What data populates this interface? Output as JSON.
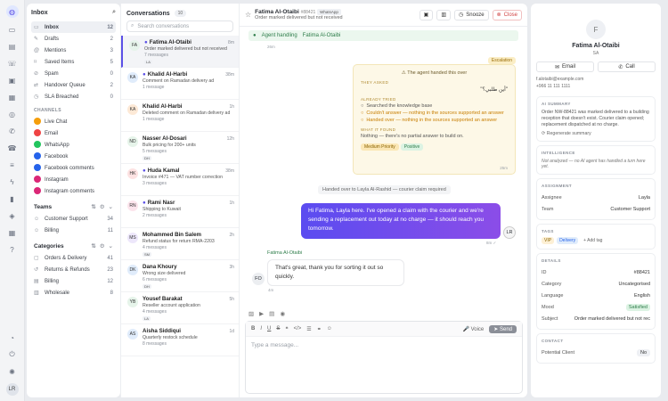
{
  "rail": {
    "icons": [
      "chat-logo-icon",
      "inbox-icon",
      "document-icon",
      "contacts-icon",
      "archive-icon",
      "box-icon",
      "broadcast-icon",
      "phone-icon",
      "call-icon",
      "sliders-icon",
      "bolt-icon",
      "chart-icon",
      "layers-icon",
      "table-icon",
      "help-icon",
      "bell-icon",
      "power-icon",
      "light-icon"
    ],
    "avatar": "LR"
  },
  "sidebar": {
    "title": "Inbox",
    "items": [
      {
        "label": "Inbox",
        "count": "12"
      },
      {
        "label": "Drafts",
        "count": "2"
      },
      {
        "label": "Mentions",
        "count": "3"
      },
      {
        "label": "Saved Items",
        "count": "5"
      },
      {
        "label": "Spam",
        "count": "0"
      },
      {
        "label": "Handover Queue",
        "count": "2"
      },
      {
        "label": "SLA Breached",
        "count": "0"
      }
    ],
    "channels_label": "CHANNELS",
    "channels": [
      {
        "label": "Live Chat",
        "color": "#f59e0b"
      },
      {
        "label": "Email",
        "color": "#ef4444"
      },
      {
        "label": "WhatsApp",
        "color": "#22c55e"
      },
      {
        "label": "Facebook",
        "color": "#2563eb"
      },
      {
        "label": "Facebook comments",
        "color": "#2563eb"
      },
      {
        "label": "Instagram",
        "color": "#db2777"
      },
      {
        "label": "Instagram comments",
        "color": "#db2777"
      }
    ],
    "teams_label": "Teams",
    "teams": [
      {
        "label": "Customer Support",
        "count": "34"
      },
      {
        "label": "Billing",
        "count": "11"
      }
    ],
    "categories_label": "Categories",
    "categories": [
      {
        "label": "Orders & Delivery",
        "count": "41"
      },
      {
        "label": "Returns & Refunds",
        "count": "23"
      },
      {
        "label": "Billing",
        "count": "12"
      },
      {
        "label": "Wholesale",
        "count": "8"
      }
    ]
  },
  "conversations": {
    "title": "Conversations",
    "count": "10",
    "search_placeholder": "Search conversations",
    "items": [
      {
        "initials": "FA",
        "name": "Fatima Al-Otaibi",
        "time": "8m",
        "preview": "Order marked delivered but not received",
        "count": "7 messages",
        "tag": "LA",
        "unread": true,
        "bg": "#e6f4ea"
      },
      {
        "initials": "KA",
        "name": "Khalid Al-Harbi",
        "time": "38m",
        "preview": "Comment on Ramadan delivery ad",
        "count": "1 message",
        "tag": "",
        "unread": true,
        "bg": "#e0ecfb"
      },
      {
        "initials": "KA",
        "name": "Khalid Al-Harbi",
        "time": "1h",
        "preview": "Deleted comment on Ramadan delivery ad",
        "count": "1 message",
        "tag": "",
        "unread": false,
        "bg": "#fde9d6"
      },
      {
        "initials": "ND",
        "name": "Nasser Al-Dosari",
        "time": "12h",
        "preview": "Bulk pricing for 200+ units",
        "count": "5 messages",
        "tag": "DH",
        "unread": false,
        "bg": "#e6f4ea"
      },
      {
        "initials": "HK",
        "name": "Huda Kamal",
        "time": "38m",
        "preview": "Invoice #471 — VAT number correction",
        "count": "3 messages",
        "tag": "",
        "unread": true,
        "bg": "#fde2e2"
      },
      {
        "initials": "RN",
        "name": "Rami Nasr",
        "time": "1h",
        "preview": "Shipping to Kuwait",
        "count": "2 messages",
        "tag": "",
        "unread": true,
        "bg": "#fce4ec"
      },
      {
        "initials": "MS",
        "name": "Mohammed Bin Salem",
        "time": "2h",
        "preview": "Refund status for return RMA-2203",
        "count": "4 messages",
        "tag": "SM",
        "unread": false,
        "bg": "#ede7fb"
      },
      {
        "initials": "DK",
        "name": "Dana Khoury",
        "time": "3h",
        "preview": "Wrong size delivered",
        "count": "6 messages",
        "tag": "DH",
        "unread": false,
        "bg": "#e0ecfb"
      },
      {
        "initials": "YB",
        "name": "Yousef Barakat",
        "time": "5h",
        "preview": "Reseller account application",
        "count": "4 messages",
        "tag": "LA",
        "unread": false,
        "bg": "#e6f4ea"
      },
      {
        "initials": "AS",
        "name": "Aisha Siddiqui",
        "time": "1d",
        "preview": "Quarterly restock schedule",
        "count": "8 messages",
        "tag": "",
        "unread": false,
        "bg": "#e0ecfb"
      }
    ]
  },
  "thread": {
    "name": "Fatima Al-Otaibi",
    "id": "#88421",
    "channel": "WhatsApp",
    "subject": "Order marked delivered but not received",
    "snooze": "Snooze",
    "close": "Close",
    "banner_label": "Agent handling",
    "banner_agent": "Fatima Al-Otaibi",
    "banner_time": "26m",
    "escalation": {
      "chip": "Escalation",
      "title": "The agent handed this over",
      "they_asked": "THEY ASKED",
      "question": "\"أين طلبي؟\"",
      "already_tried": "ALREADY TRIED",
      "tried": [
        "Searched the knowledge base",
        "Couldn't answer — nothing in the sources supported an answer",
        "Handed over — nothing in the sources supported an answer"
      ],
      "what_found": "WHAT IT FOUND",
      "found": "Nothing — there's no partial answer to build on.",
      "badges": [
        "Medium Priority",
        "Positive"
      ],
      "time": "25m"
    },
    "system": "Handed over to Layla Al-Rashid — courier claim required",
    "outgoing": "Hi Fatima, Layla here. I've opened a claim with the courier and we're sending a replacement out today at no charge — it should reach you tomorrow.",
    "outgoing_time": "8m ✓",
    "outgoing_avatar": "LR",
    "incoming_sender": "Fatima Al-Otaibi",
    "incoming": "That's great, thank you for sorting it out so quickly.",
    "incoming_time": "4m",
    "incoming_avatar": "FO",
    "composer": {
      "voice": "Voice",
      "send": "Send",
      "placeholder": "Type a message..."
    }
  },
  "contact": {
    "initial": "F",
    "name": "Fatima Al-Otaibi",
    "country": "SA",
    "email_btn": "Email",
    "call_btn": "Call",
    "email": "f.alotaibi@example.com",
    "phone": "+966 11 111 1111",
    "ai_summary_label": "AI SUMMARY",
    "ai_summary": "Order NW-88421 was marked delivered to a building reception that doesn't exist. Courier claim opened; replacement dispatched at no charge.",
    "regen": "Regenerate summary",
    "intel_label": "INTELLIGENCE",
    "intel": "Not analyzed — no AI agent has handled a turn here yet.",
    "assign_label": "ASSIGNMENT",
    "assignee_k": "Assignee",
    "assignee_v": "Layla",
    "team_k": "Team",
    "team_v": "Customer Support",
    "tags_label": "TAGS",
    "tags": [
      "VIP",
      "Delivery"
    ],
    "add_tag": "+ Add tag",
    "details_label": "DETAILS",
    "details": [
      {
        "k": "ID",
        "v": "#88421"
      },
      {
        "k": "Category",
        "v": "Uncategorised"
      },
      {
        "k": "Language",
        "v": "English"
      },
      {
        "k": "Mood",
        "v": "Satisfied"
      },
      {
        "k": "Subject",
        "v": "Order marked delivered but not rec"
      }
    ],
    "contact_label": "CONTACT",
    "potential_k": "Potential Client",
    "potential_v": "No"
  }
}
